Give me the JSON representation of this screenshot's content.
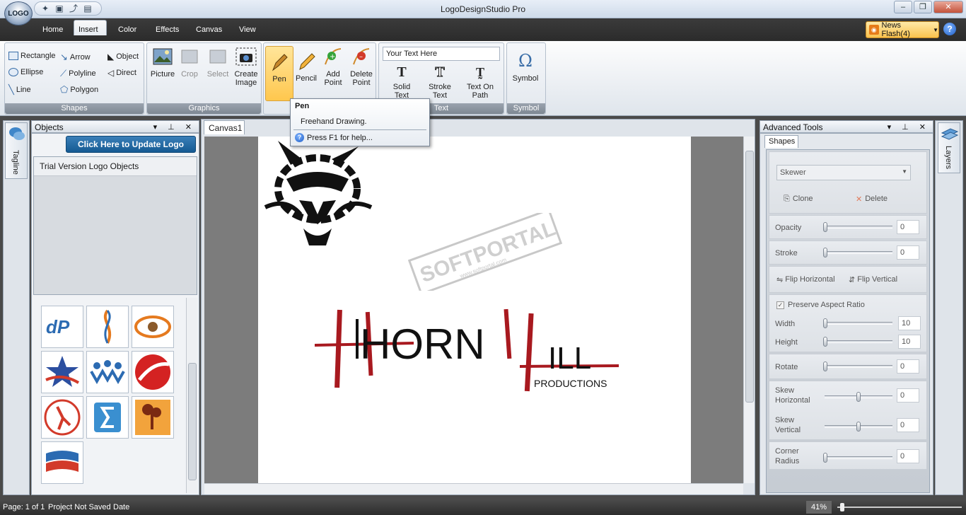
{
  "window": {
    "title": "LogoDesignStudio Pro",
    "orb_label": "LOGO"
  },
  "menu": {
    "tabs": [
      "Home",
      "Insert",
      "Color",
      "Effects",
      "Canvas",
      "View"
    ],
    "active_tab": "Insert",
    "news_label": "News Flash(4)",
    "help_icon": "help-icon"
  },
  "ribbon": {
    "shapes": {
      "label": "Shapes",
      "items": [
        "Rectangle",
        "Arrow",
        "Object",
        "Ellipse",
        "Polyline",
        "Direct",
        "Line",
        "Polygon"
      ]
    },
    "graphics": {
      "label": "Graphics",
      "items": [
        "Picture",
        "Crop",
        "Select"
      ],
      "create_line1": "Create",
      "create_line2": "Image"
    },
    "draw": {
      "pen": "Pen",
      "pencil": "Pencil",
      "add_line1": "Add",
      "add_line2": "Point",
      "delete_line1": "Delete",
      "delete_line2": "Point"
    },
    "text": {
      "label": "Text",
      "input_value": "Your Text Here",
      "solid_line1": "Solid",
      "solid_line2": "Text",
      "stroke_line1": "Stroke",
      "stroke_line2": "Text",
      "path_line1": "Text On",
      "path_line2": "Path"
    },
    "symbol": {
      "label": "Symbol",
      "button": "Symbol",
      "glyph": "Ω"
    }
  },
  "tooltip": {
    "title": "Pen",
    "body": "Freehand Drawing.",
    "help": "Press F1 for help..."
  },
  "left_strip": {
    "tab": "Tagline"
  },
  "right_strip": {
    "tab": "Layers"
  },
  "objects_panel": {
    "title": "Objects",
    "header_icons": "▾ ⊥ ✕",
    "update_button": "Click Here to Update Logo Content",
    "trial_label": "Trial Version Logo Objects"
  },
  "canvas": {
    "tab": "Canvas1",
    "watermark": "SOFTPORTAL",
    "watermark_sub": "www.softportal.com",
    "logo_word_1": "HORN",
    "logo_word_2": "ILL",
    "logo_sub": "PRODUCTIONS"
  },
  "advanced": {
    "title": "Advanced Tools",
    "header_icons": "▾ ⊥ ✕",
    "tab": "Shapes",
    "dropdown_value": "Skewer",
    "clone": "Clone",
    "delete": "Delete",
    "opacity_label": "Opacity",
    "opacity_value": "0",
    "stroke_label": "Stroke",
    "stroke_value": "0",
    "flip_h": "Flip Horizontal",
    "flip_v": "Flip Vertical",
    "preserve_label": "Preserve Aspect Ratio",
    "width_label": "Width",
    "width_value": "10",
    "height_label": "Height",
    "height_value": "10",
    "rotate_label": "Rotate",
    "rotate_value": "0",
    "skew_h_line1": "Skew",
    "skew_h_line2": "Horizontal",
    "skew_h_value": "0",
    "skew_v_line1": "Skew",
    "skew_v_line2": "Vertical",
    "skew_v_value": "0",
    "corner_line1": "Corner",
    "corner_line2": "Radius",
    "corner_value": "0"
  },
  "status": {
    "page": "Page: 1 of 1",
    "saved": "Project Not Saved",
    "date": "Date",
    "zoom": "41%"
  },
  "colors": {
    "accent_brand": "#155a93",
    "logo_red": "#a8191f",
    "news_orange": "#f9c24e"
  }
}
